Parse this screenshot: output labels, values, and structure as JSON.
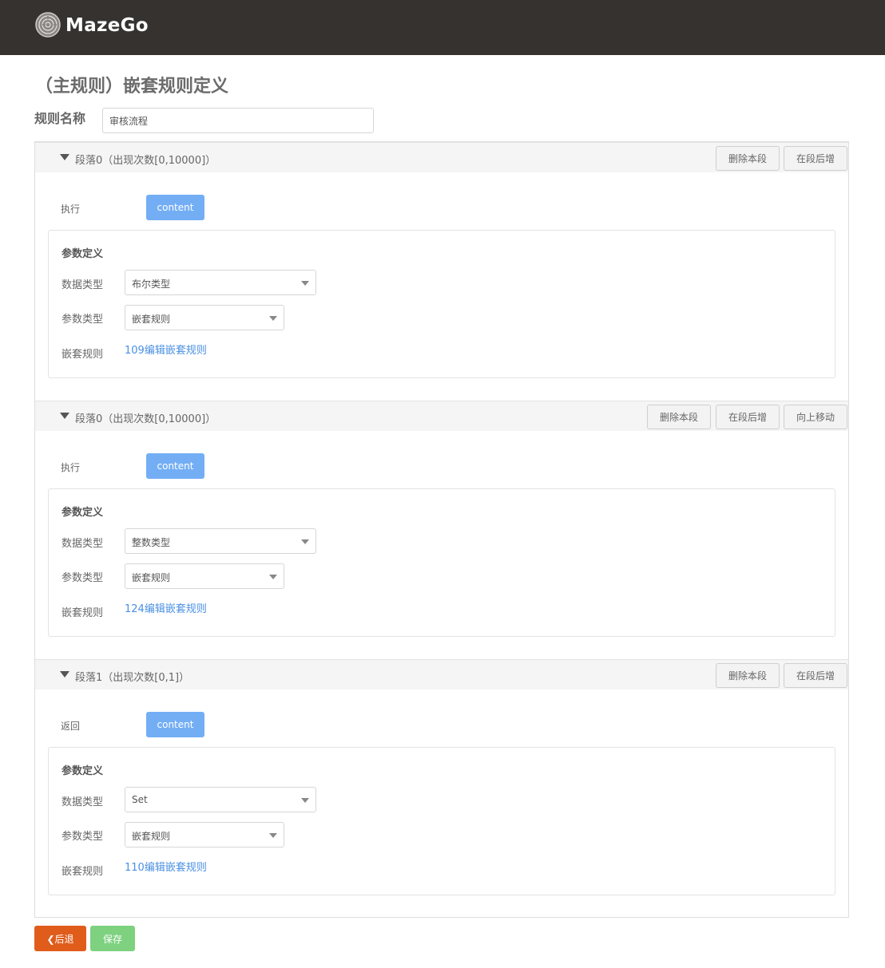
{
  "header": {
    "brand": "MazeGo",
    "logo_icon": "maze-logo-icon"
  },
  "page_title": "（主规则）嵌套规则定义",
  "rule_name": {
    "label": "规则名称",
    "value": "审核流程"
  },
  "colors": {
    "header_bg": "#353230",
    "primary": "#73aef5",
    "link": "#4a90e2",
    "back": "#e05c1b",
    "save": "#7dd17f"
  },
  "segments": [
    {
      "title": "段落0（出现次数[0,10000]）",
      "buttons": [
        "删除本段",
        "在段后增"
      ],
      "action_label": "执行",
      "content_label": "content",
      "param_title": "参数定义",
      "data_type_label": "数据类型",
      "data_type_value": "布尔类型",
      "param_type_label": "参数类型",
      "param_type_value": "嵌套规则",
      "nested_label": "嵌套规则",
      "nested_link": "109编辑嵌套规则"
    },
    {
      "title": "段落0（出现次数[0,10000]）",
      "buttons": [
        "删除本段",
        "在段后增",
        "向上移动"
      ],
      "action_label": "执行",
      "content_label": "content",
      "param_title": "参数定义",
      "data_type_label": "数据类型",
      "data_type_value": "整数类型",
      "param_type_label": "参数类型",
      "param_type_value": "嵌套规则",
      "nested_label": "嵌套规则",
      "nested_link": "124编辑嵌套规则"
    },
    {
      "title": "段落1（出现次数[0,1]）",
      "buttons": [
        "删除本段",
        "在段后增"
      ],
      "action_label": "返回",
      "content_label": "content",
      "param_title": "参数定义",
      "data_type_label": "数据类型",
      "data_type_value": "Set",
      "param_type_label": "参数类型",
      "param_type_value": "嵌套规则",
      "nested_label": "嵌套规则",
      "nested_link": "110编辑嵌套规则"
    }
  ],
  "footer": {
    "back_label": "后退",
    "save_label": "保存"
  }
}
